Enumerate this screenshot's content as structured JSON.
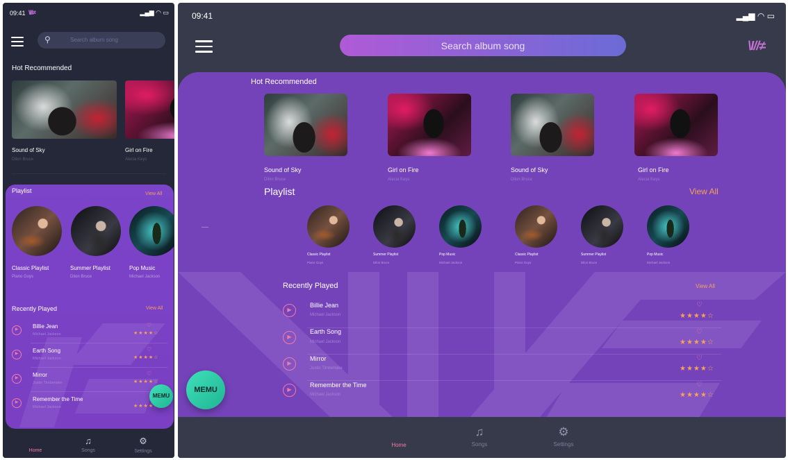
{
  "status": {
    "time": "09:41",
    "brand_small": "\\I//≠"
  },
  "search": {
    "placeholder": "Search album song"
  },
  "brand": "\\I//≠",
  "hot": {
    "title": "Hot Recommended",
    "items": [
      {
        "title": "Sound of Sky",
        "artist": "Dilon Bruce"
      },
      {
        "title": "Girl on Fire",
        "artist": "Alecia Keys"
      },
      {
        "title": "Sound of Sky",
        "artist": "Dilon Bruce"
      },
      {
        "title": "Girl on Fire",
        "artist": "Alecia Keys"
      }
    ]
  },
  "playlist": {
    "title": "Playlist",
    "view_all": "View All",
    "items": [
      {
        "title": "Classic Playlist",
        "artist": "Piano Guys"
      },
      {
        "title": "Summer Playlist",
        "artist": "Dilon Bruce"
      },
      {
        "title": "Pop Music",
        "artist": "Michael Jackson"
      },
      {
        "title": "Classic Playlist",
        "artist": "Piano Guys"
      },
      {
        "title": "Summer Playlist",
        "artist": "Dilon Bruce"
      },
      {
        "title": "Pop Music",
        "artist": "Michael Jackson"
      }
    ]
  },
  "recent": {
    "title": "Recently Played",
    "view_all": "View All",
    "items": [
      {
        "title": "Billie Jean",
        "artist": "Michael Jackson",
        "rating": "★★★★☆"
      },
      {
        "title": "Earth Song",
        "artist": "Michael Jackson",
        "rating": "★★★★☆"
      },
      {
        "title": "Mirror",
        "artist": "Justin Timberlake",
        "rating": "★★★★☆"
      },
      {
        "title": "Remember the Time",
        "artist": "Michael Jackson",
        "rating": "★★★★☆"
      }
    ]
  },
  "fab": {
    "label": "MEMU"
  },
  "tabs": [
    {
      "label": "Home",
      "active": true
    },
    {
      "label": "Songs",
      "active": false
    },
    {
      "label": "Settings",
      "active": false
    }
  ],
  "colors": {
    "accent": "#f47aa6",
    "panel": "#7443b9",
    "orange": "#f5a25a",
    "fab": "#2ecfa8"
  }
}
